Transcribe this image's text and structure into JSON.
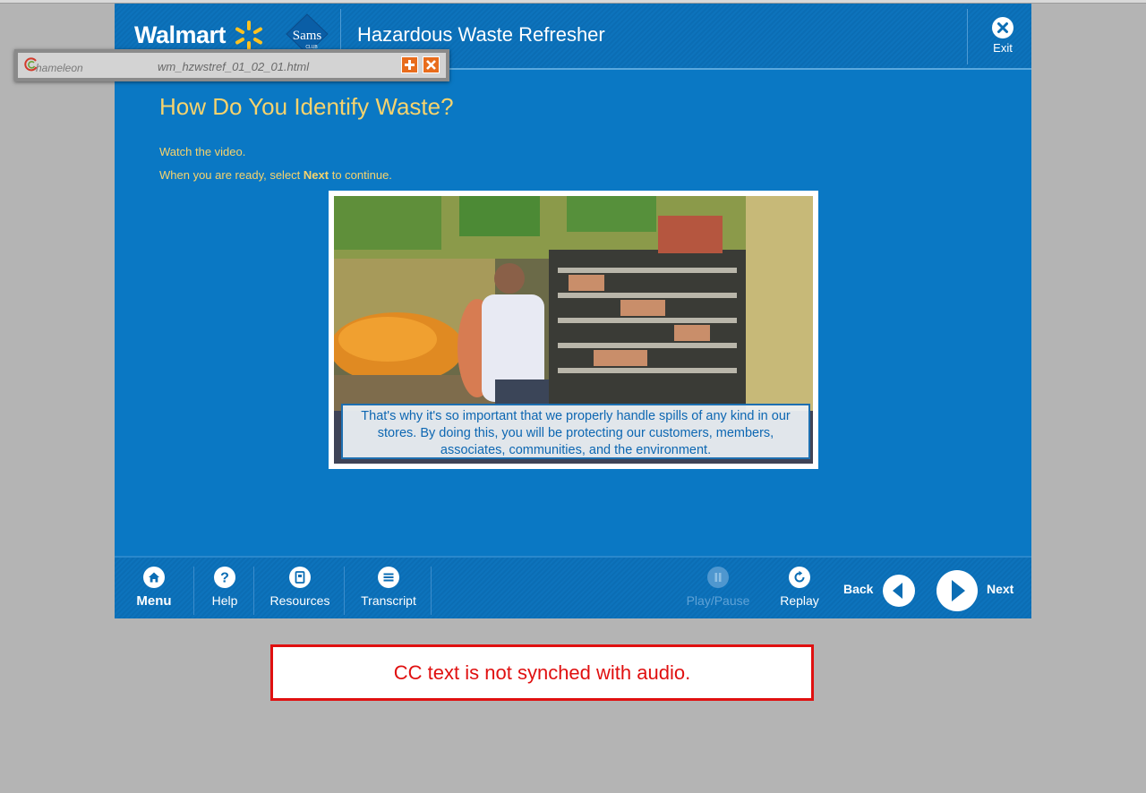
{
  "header": {
    "brand": "Walmart",
    "sub_brand": "Sams",
    "sub_brand_small": "CLUB",
    "course_title": "Hazardous Waste Refresher",
    "exit_label": "Exit"
  },
  "toolbar": {
    "brand": "hameleon",
    "filename": "wm_hzwstref_01_02_01.html"
  },
  "content": {
    "title": "How Do You Identify Waste?",
    "instruction_1": "Watch the video.",
    "instruction_2_pre": "When you are ready, select ",
    "instruction_2_bold": "Next",
    "instruction_2_post": " to continue.",
    "caption": "That's why it's so important that we properly handle spills of any kind in our stores.  By doing this, you will be protecting our customers, members, associates, communities, and the environment."
  },
  "footer": {
    "menu": "Menu",
    "help": "Help",
    "resources": "Resources",
    "transcript": "Transcript",
    "play_pause": "Play/Pause",
    "replay": "Replay",
    "back": "Back",
    "next": "Next"
  },
  "annotation": {
    "text": "CC text is not synched with audio."
  },
  "colors": {
    "player_blue": "#0a78c4",
    "title_gold": "#f6d36d",
    "annotation_red": "#e01010",
    "toolbar_orange": "#e86c1c"
  }
}
